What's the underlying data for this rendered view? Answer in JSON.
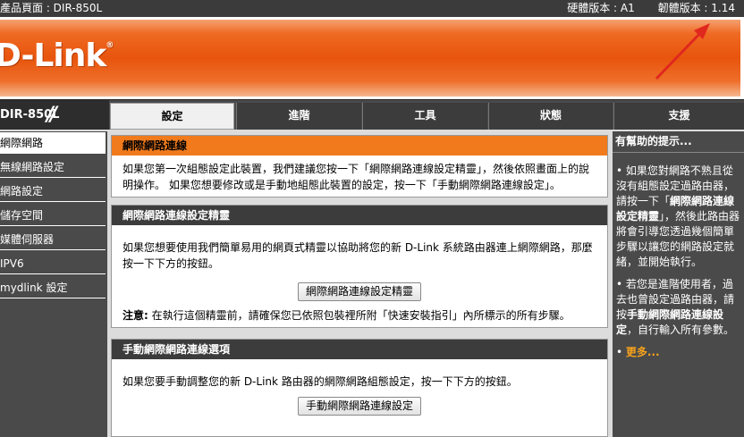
{
  "topbar": {
    "product": "產品頁面 : DIR-850L",
    "hardware": "硬體版本 : A1",
    "firmware": "韌體版本 : 1.14"
  },
  "brand": {
    "logo": "D-Link",
    "mark": "®"
  },
  "model": "DIR-850L",
  "tabs": [
    {
      "label": "設定"
    },
    {
      "label": "進階"
    },
    {
      "label": "工具"
    },
    {
      "label": "狀態"
    },
    {
      "label": "支援"
    }
  ],
  "sidebar": {
    "items": [
      {
        "label": "網際網路"
      },
      {
        "label": "無線網路設定"
      },
      {
        "label": "網路設定"
      },
      {
        "label": "儲存空間"
      },
      {
        "label": "媒體伺服器"
      },
      {
        "label": "IPV6"
      },
      {
        "label": "mydlink 設定"
      }
    ]
  },
  "main": {
    "section1": {
      "title": "網際網路連線",
      "text": "如果您第一次組態設定此裝置，我們建議您按一下「網際網路連線設定精靈」，然後依照畫面上的說明操作。 如果您想要修改或是手動地組態此裝置的設定，按一下「手動網際網路連線設定」。"
    },
    "section2": {
      "title": "網際網路連線設定精靈",
      "text": "如果您想要使用我們簡單易用的網頁式精靈以協助將您的新 D-Link 系統路由器連上網際網路，那麼按一下下方的按鈕。",
      "button": "網際網路連線設定精靈",
      "note_label": "注意:",
      "note": " 在執行這個精靈前，請確保您已依照包裝裡所附「快速安裝指引」內所標示的所有步驟。"
    },
    "section3": {
      "title": "手動網際網路連線選項",
      "text": "如果您要手動調整您的新 D-Link 路由器的網際網路組態設定，按一下下方的按鈕。",
      "button": "手動網際網路連線設定"
    }
  },
  "help": {
    "title": "有幫助的提示...",
    "tip1_pre": "如果您對網路不熟且從沒有組態設定過路由器，請按一下「",
    "tip1_bold": "網際網路連線設定精靈",
    "tip1_post": "」，然後此路由器將會引導您透過幾個簡單步驟以讓您的網路設定就緒，並開始執行。",
    "tip2_pre": "若您是進階使用者，過去也曾設定過路由器，請按",
    "tip2_bold": "手動網際網路連線設定",
    "tip2_post": "，自行輸入所有參數。",
    "more": "更多..."
  }
}
